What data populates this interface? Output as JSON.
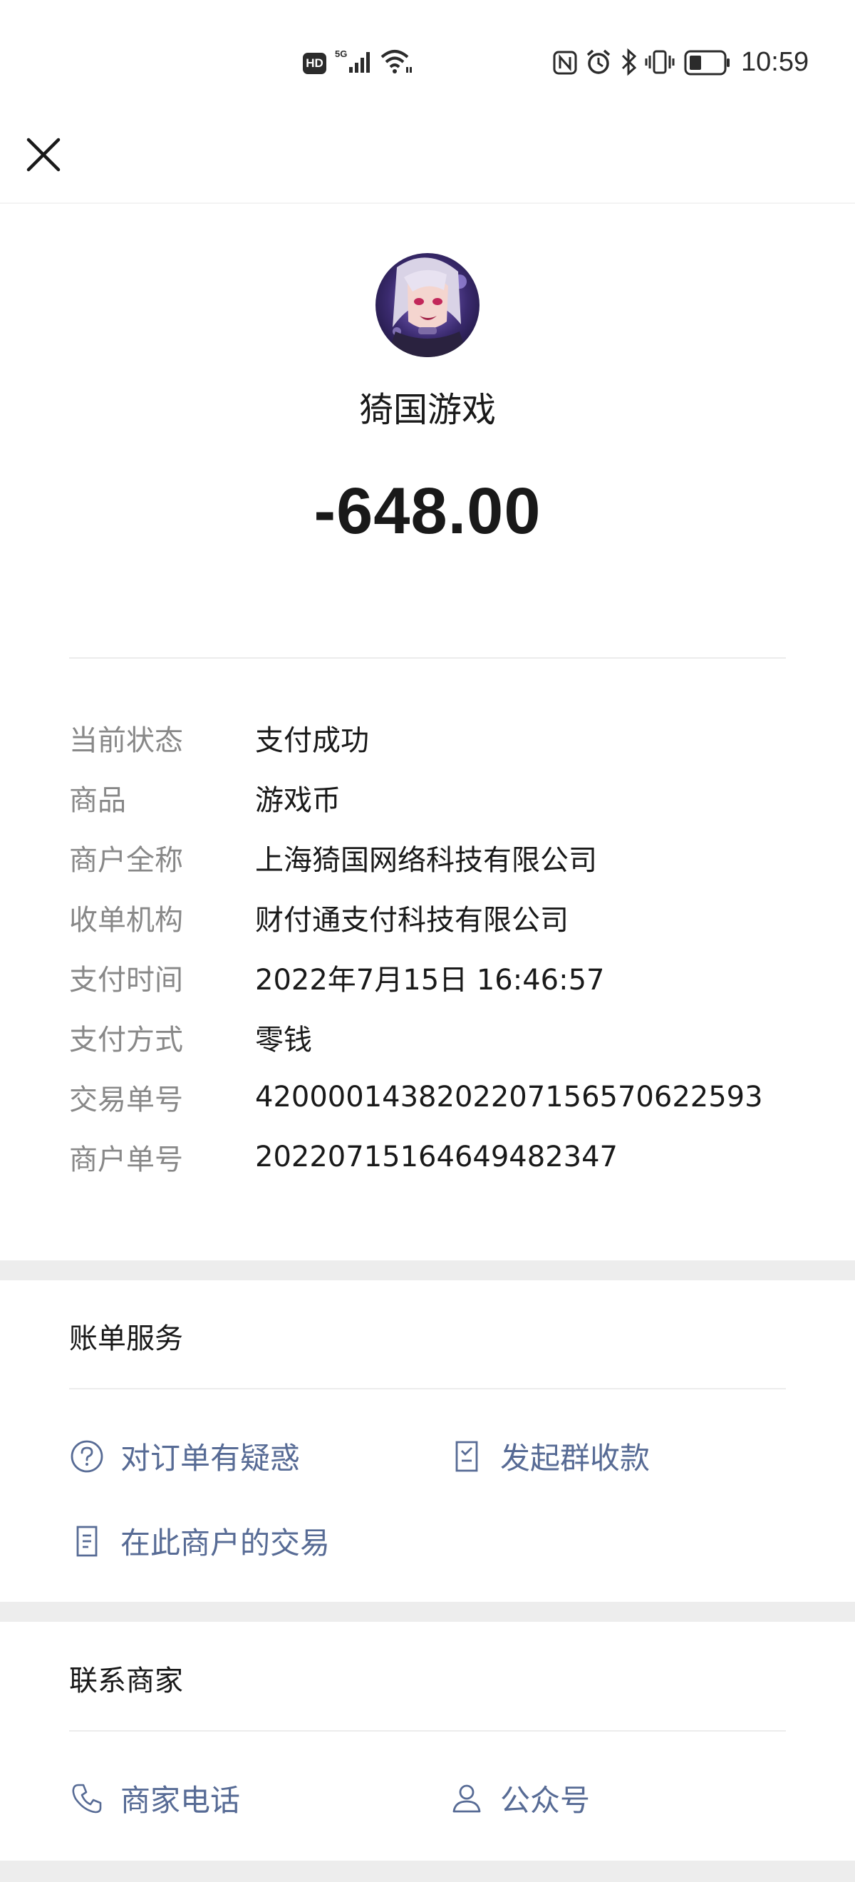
{
  "status_bar": {
    "hd": "HD",
    "network": "5G",
    "time": "10:59"
  },
  "merchant": {
    "name": "猗国游戏",
    "amount": "-648.00"
  },
  "details": [
    {
      "label": "当前状态",
      "value": "支付成功"
    },
    {
      "label": "商品",
      "value": "游戏币"
    },
    {
      "label": "商户全称",
      "value": "上海猗国网络科技有限公司"
    },
    {
      "label": "收单机构",
      "value": "财付通支付科技有限公司"
    },
    {
      "label": "支付时间",
      "value": "2022年7月15日 16:46:57"
    },
    {
      "label": "支付方式",
      "value": "零钱"
    },
    {
      "label": "交易单号",
      "value": "4200001438202207156570622593"
    },
    {
      "label": "商户单号",
      "value": "20220715164649482347"
    }
  ],
  "bill_service": {
    "title": "账单服务",
    "question": "对订单有疑惑",
    "group_collect": "发起群收款",
    "merchant_trades": "在此商户的交易"
  },
  "contact": {
    "title": "联系商家",
    "phone": "商家电话",
    "official_account": "公众号"
  },
  "colors": {
    "link": "#576b95",
    "label": "#888888",
    "text": "#191919",
    "gap": "#ededed"
  }
}
